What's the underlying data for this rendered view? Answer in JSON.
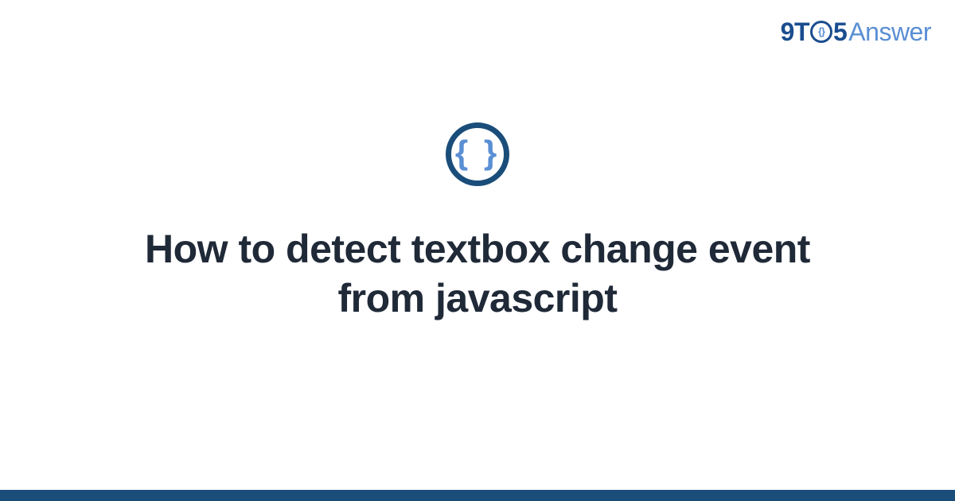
{
  "brand": {
    "part1": "9T",
    "zero_inner": "{}",
    "part2": "5",
    "part3": "Answer"
  },
  "category": {
    "icon_glyph": "{ }"
  },
  "title": "How to detect textbox change event from javascript",
  "colors": {
    "primary_dark": "#1a4d7a",
    "primary_light": "#5a8fd4",
    "text": "#1f2937"
  }
}
